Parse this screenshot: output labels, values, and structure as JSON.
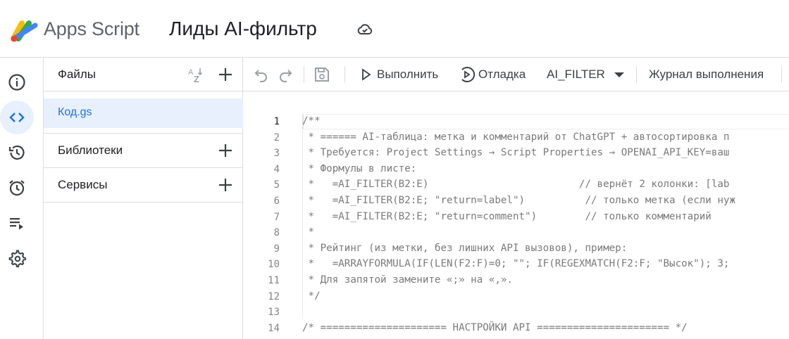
{
  "header": {
    "app_name": "Apps Script",
    "project_title": "Лиды AI-фильтр"
  },
  "files_panel": {
    "title": "Файлы",
    "files": [
      {
        "name": "Код.gs"
      }
    ],
    "libraries": "Библиотеки",
    "services": "Сервисы"
  },
  "toolbar": {
    "run_label": "Выполнить",
    "debug_label": "Отладка",
    "function_name": "AI_FILTER",
    "log_label": "Журнал выполнения"
  },
  "rail": {
    "items": [
      "overview-icon",
      "code-icon",
      "history-icon",
      "triggers-icon",
      "executions-icon",
      "settings-icon"
    ],
    "active": "code-icon"
  },
  "colors": {
    "accent": "#1a73e8",
    "active_bg": "#e8f0fe",
    "border": "#dadce0"
  },
  "editor": {
    "current_line": 1,
    "line_numbers": [
      "1",
      "2",
      "3",
      "4",
      "5",
      "6",
      "7",
      "8",
      "9",
      "10",
      "11",
      "12",
      "13",
      "14"
    ],
    "lines": [
      "/**",
      " * ====== AI-таблица: метка и комментарий от ChatGPT + автосортировка п",
      " * Требуется: Project Settings → Script Properties → OPENAI_API_KEY=ваш",
      " * Формулы в листе:",
      " *   =AI_FILTER(B2:E)                         // вернёт 2 колонки: [lab",
      " *   =AI_FILTER(B2:E; \"return=label\")          // только метка (если нуж",
      " *   =AI_FILTER(B2:E; \"return=comment\")        // только комментарий",
      " *",
      " * Рейтинг (из метки, без лишних API вызовов), пример:",
      " *   =ARRAYFORMULA(IF(LEN(F2:F)=0; \"\"; IF(REGEXMATCH(F2:F; \"Высок\"); 3;",
      " * Для запятой замените «;» на «,».",
      " */",
      "",
      "/* ===================== НАСТРОЙКИ API ====================== */"
    ]
  }
}
